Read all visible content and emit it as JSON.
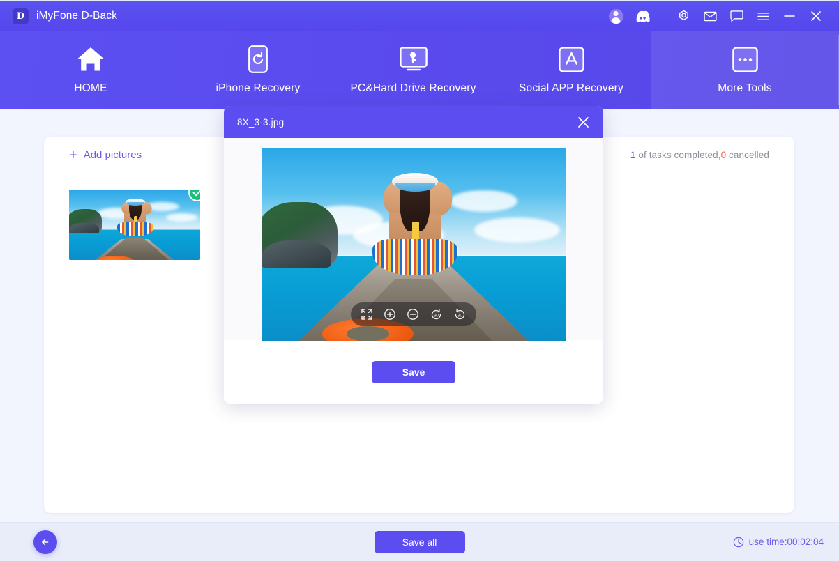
{
  "app": {
    "brand_mark": "D",
    "title": "iMyFone D-Back"
  },
  "titlebar": {
    "icons": [
      {
        "name": "user-avatar-icon",
        "label": "account"
      },
      {
        "name": "discord-icon",
        "label": "discord"
      },
      {
        "name": "target-icon",
        "label": "settings-target"
      },
      {
        "name": "mail-icon",
        "label": "email"
      },
      {
        "name": "chat-icon",
        "label": "feedback"
      },
      {
        "name": "menu-icon",
        "label": "menu"
      },
      {
        "name": "minimize-icon",
        "label": "minimize"
      },
      {
        "name": "close-icon",
        "label": "close"
      }
    ]
  },
  "nav": {
    "items": [
      {
        "label": "HOME",
        "icon": "home-icon",
        "active": false
      },
      {
        "label": "iPhone Recovery",
        "icon": "phone-refresh-icon",
        "active": false
      },
      {
        "label": "PC&Hard Drive Recovery",
        "icon": "monitor-key-icon",
        "active": false
      },
      {
        "label": "Social APP Recovery",
        "icon": "appstore-icon",
        "active": false
      },
      {
        "label": "More Tools",
        "icon": "ellipsis-box-icon",
        "active": true
      }
    ]
  },
  "main": {
    "add_pictures_label": "Add pictures",
    "add_icon": "plus-icon",
    "status": {
      "completed_count": "1",
      "mid_text": " of tasks completed,",
      "cancelled_count": "0",
      "cancelled_text": " cancelled",
      "completed_color": "#6a5bf0",
      "cancelled_color": "#f0604d"
    },
    "thumbnails": [
      {
        "name": "8X_3-3.jpg",
        "selected": true,
        "badge_icon": "check-circle-icon"
      }
    ]
  },
  "modal": {
    "title": "8X_3-3.jpg",
    "close_icon": "close-icon",
    "save_label": "Save",
    "image_toolbar": [
      {
        "name": "fullscreen-icon",
        "label": "fullscreen"
      },
      {
        "name": "zoom-in-icon",
        "label": "zoom in"
      },
      {
        "name": "zoom-out-icon",
        "label": "zoom out"
      },
      {
        "name": "rotate-left-90-icon",
        "label": "rotate left 90"
      },
      {
        "name": "rotate-right-90-icon",
        "label": "rotate right 90"
      }
    ]
  },
  "footer": {
    "back_icon": "arrow-left-icon",
    "save_all_label": "Save all",
    "clock_icon": "clock-icon",
    "use_time_label": "use time:00:02:04"
  },
  "colors": {
    "brand_purple": "#5c4df0",
    "header_gradient_start": "#5c50f2",
    "header_gradient_end": "#5747e9",
    "page_bg": "#f2f5fd",
    "footer_bg": "#e9edfa",
    "success_green": "#18c07a",
    "danger_red": "#f0604d"
  }
}
